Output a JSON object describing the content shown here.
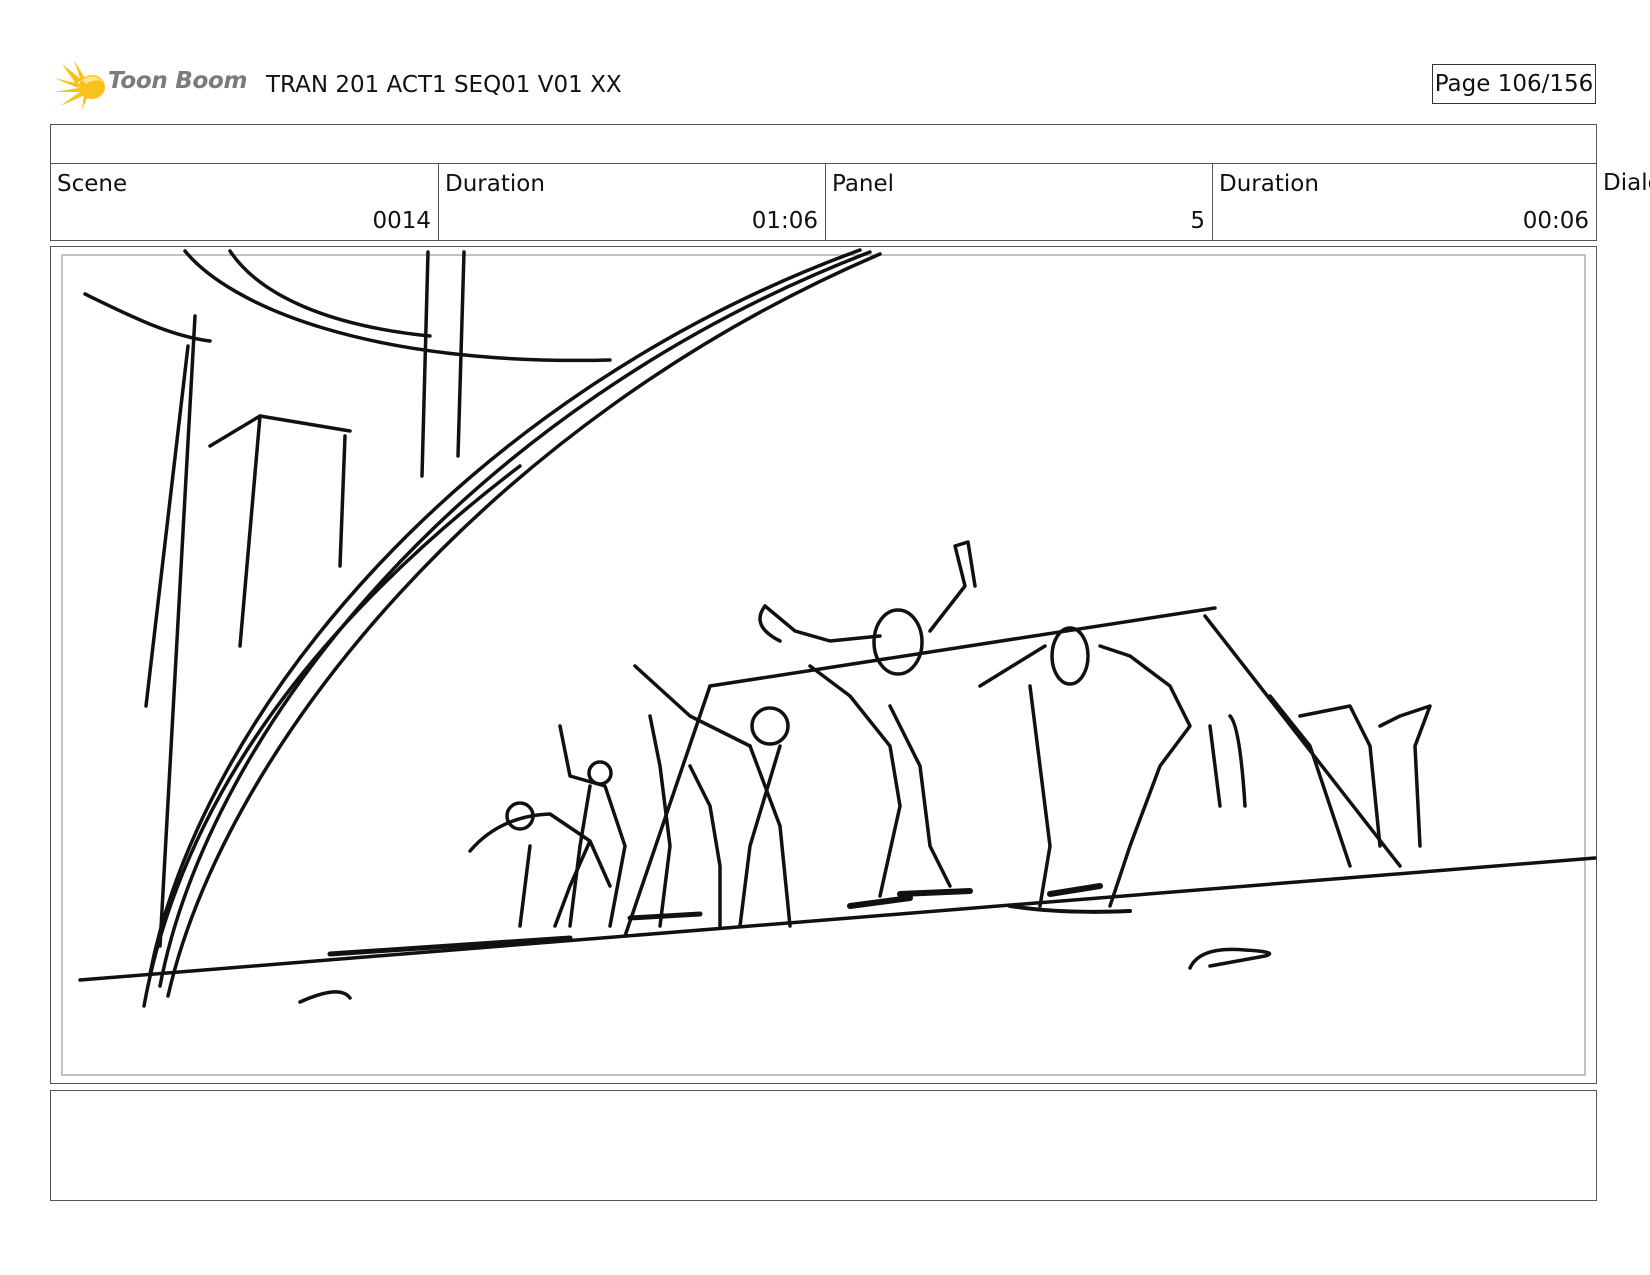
{
  "header": {
    "logo_text": "Toon Boom",
    "logo_icon": "sunburst-logo-icon",
    "title": "TRAN 201 ACT1 SEQ01 V01 XX",
    "page": "Page 106/156"
  },
  "info": {
    "scene_label": "Scene",
    "scene_value": "0014",
    "scene_duration_label": "Duration",
    "scene_duration_value": "01:06",
    "panel_label": "Panel",
    "panel_value": "5",
    "panel_duration_label": "Duration",
    "panel_duration_value": "00:06",
    "dialog_label": "Dialo"
  },
  "colors": {
    "logo_yellow": "#f7c21b",
    "logo_text": "#7b7b7b",
    "border": "#555555",
    "safe_frame": "#c2c2c2"
  }
}
